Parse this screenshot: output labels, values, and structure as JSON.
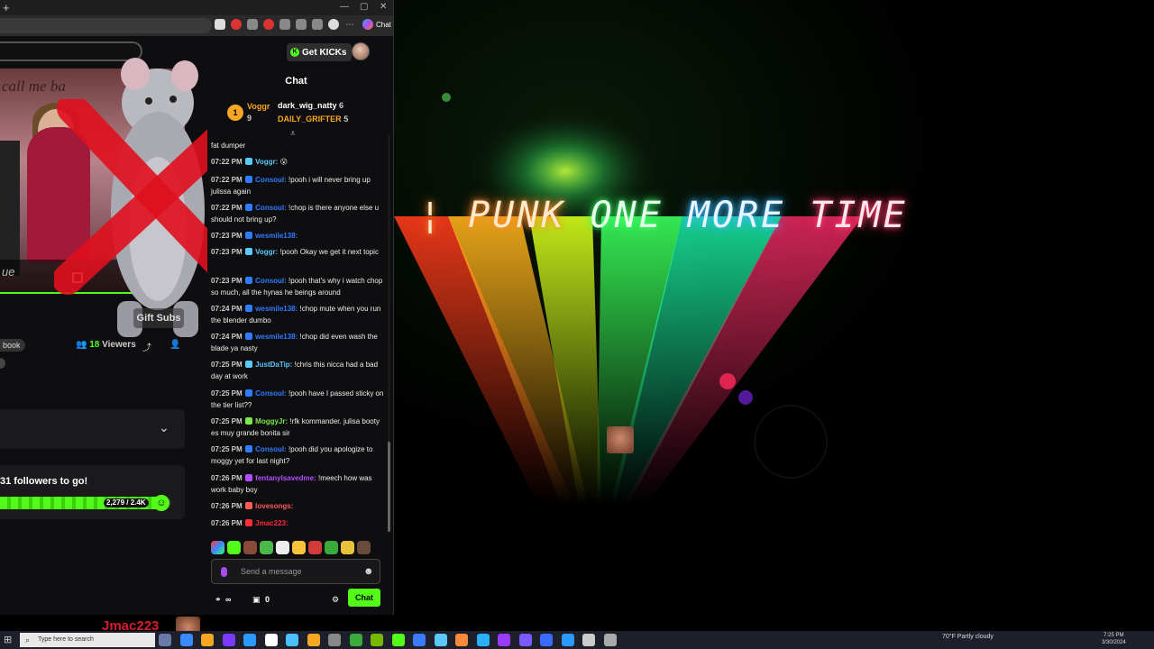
{
  "browser": {
    "new_tab": "+",
    "minimize": "—",
    "maximize": "▢",
    "close": "✕",
    "copilot_label": "Chat"
  },
  "site": {
    "video_title": "call me ba",
    "video_caption": "ue",
    "gift_subs": "Gift Subs",
    "book_tag": "book",
    "viewers_count": "18",
    "viewers_label": " Viewers",
    "goal_text": "31 followers to go!",
    "goal_count": "2,279 / 2.4K",
    "goal_fraction": 0.95
  },
  "chat": {
    "get_kicks": "Get KICKs",
    "title": "Chat",
    "leaders": [
      {
        "name": "Voggr",
        "count": "9",
        "color": "#f5a623"
      },
      {
        "name": "dark_wig_natty",
        "count": "6",
        "color": "#ffffff"
      },
      {
        "name": "DAILY_GRIFTER",
        "count": "5",
        "color": "#f5a623"
      }
    ],
    "rank_badge": "1",
    "messages": [
      {
        "time": "",
        "user": "",
        "color": "#eee",
        "text": "fat dumper"
      },
      {
        "time": "07:22 PM",
        "user": "Voggr:",
        "color": "#5ac8fa",
        "text": " 😮"
      },
      {
        "time": "07:22 PM",
        "user": "Consoul:",
        "color": "#2f7bff",
        "text": " !pooh i will never bring up julissa again"
      },
      {
        "time": "07:22 PM",
        "user": "Consoul:",
        "color": "#2f7bff",
        "text": " !chop is there anyone else u should not bring up?"
      },
      {
        "time": "07:23 PM",
        "user": "wesmile138:",
        "color": "#2f7bff",
        "text": ""
      },
      {
        "time": "07:23 PM",
        "user": "Voggr:",
        "color": "#5ac8fa",
        "text": " !pooh Okay we get it next topic"
      },
      {
        "time": "07:23 PM",
        "user": "Consoul:",
        "color": "#2f7bff",
        "text": " !pooh that's why i watch chop so much, all the hynas he beings around"
      },
      {
        "time": "07:24 PM",
        "user": "wesmile138:",
        "color": "#2f7bff",
        "text": " !chop mute when you run the blender dumbo"
      },
      {
        "time": "07:24 PM",
        "user": "wesmile138:",
        "color": "#2f7bff",
        "text": " !chop did even wash the blade ya nasty"
      },
      {
        "time": "07:25 PM",
        "user": "JustDaTip:",
        "color": "#5ac8fa",
        "text": " !chris this nicca had a bad day at work"
      },
      {
        "time": "07:25 PM",
        "user": "Consoul:",
        "color": "#2f7bff",
        "text": " !pooh have I passed sticky on the tier list??"
      },
      {
        "time": "07:25 PM",
        "user": "MoggyJr:",
        "color": "#7ce84c",
        "text": " !rfk kommander. julisa booty es muy grande bonita sir"
      },
      {
        "time": "07:25 PM",
        "user": "Consoul:",
        "color": "#2f7bff",
        "text": " !pooh did you apologize to moggy yet for last night?"
      },
      {
        "time": "07:26 PM",
        "user": "fentanylsavedme:",
        "color": "#b34cff",
        "text": " !meech how was work baby boy"
      },
      {
        "time": "07:26 PM",
        "user": "lovesongs:",
        "color": "#ff5a5a",
        "text": ""
      },
      {
        "time": "07:26 PM",
        "user": "Jmac223:",
        "color": "#ff2a3a",
        "text": ""
      }
    ],
    "send_placeholder": "Send a message",
    "infinity": "∞",
    "points": "0",
    "chat_button": "Chat"
  },
  "stage": {
    "neon_part1": "PUNK ",
    "neon_part2": "ONE ",
    "neon_part3": "MORE ",
    "neon_part4": "TIME",
    "neon_prefix": "¦ "
  },
  "overlay": {
    "jmac": "Jmac223"
  },
  "taskbar": {
    "search_placeholder": "Type here to search",
    "weather": "70°F  Partly cloudy",
    "time": "7:25 PM",
    "date": "3/30/2024"
  }
}
